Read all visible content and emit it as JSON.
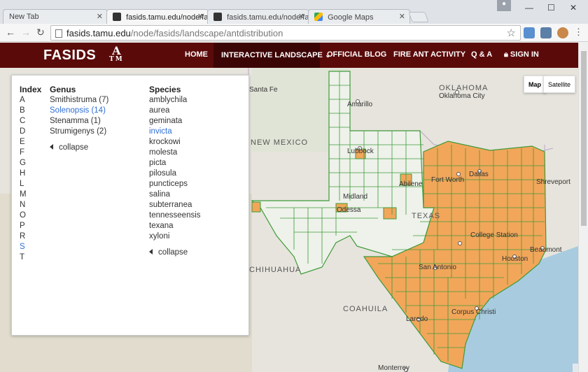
{
  "browser": {
    "tabs": [
      {
        "title": "New Tab",
        "active": false
      },
      {
        "title": "fasids.tamu.edu/node/fasi",
        "active": true
      },
      {
        "title": "fasids.tamu.edu/node/fasi",
        "active": false
      },
      {
        "title": "Google Maps",
        "active": false
      }
    ],
    "url_host": "fasids.tamu.edu",
    "url_path": "/node/fasids/landscape/antdistribution"
  },
  "site": {
    "logo": "FASIDS",
    "atm_logo_top": "A",
    "atm_logo_bottom": "TM",
    "nav": [
      {
        "label": "HOME"
      },
      {
        "label": "INTERACTIVE LANDSCAPE",
        "active": true
      },
      {
        "label": "OFFICIAL BLOG"
      },
      {
        "label": "FIRE ANT ACTIVITY"
      },
      {
        "label": "Q & A"
      },
      {
        "label": "SIGN IN"
      }
    ]
  },
  "map": {
    "type_buttons": [
      "Map",
      "Satellite"
    ],
    "labels": {
      "oklahoma": "OKLAHOMA",
      "oklahoma_city": "Oklahoma City",
      "santa_fe": "Santa Fe",
      "amarillo": "Amarillo",
      "new_mexico": "NEW MEXICO",
      "lubbock": "Lubbock",
      "abilene": "Abilene",
      "fort_worth": "Fort Worth",
      "dallas": "Dallas",
      "shreveport": "Shreveport",
      "midland": "Midland",
      "odessa": "Odessa",
      "texas": "TEXAS",
      "college_station": "College Station",
      "beaumont": "Beaumont",
      "san_antonio": "San Antonio",
      "houston": "Houston",
      "chihuahua": "CHIHUAHUA",
      "coahuila": "COAHUILA",
      "corpus_christi": "Corpus Christi",
      "laredo": "Laredo",
      "monterrey": "Monterrey"
    },
    "colors": {
      "infested": "#f2a65a",
      "border": "#3f9a3a",
      "land": "#e8e6df",
      "water": "#a8cbe0"
    }
  },
  "panel": {
    "index_title": "Index",
    "index": [
      "A",
      "B",
      "C",
      "D",
      "E",
      "F",
      "G",
      "H",
      "L",
      "M",
      "N",
      "O",
      "P",
      "R",
      "S",
      "T"
    ],
    "index_selected": "S",
    "genus_title": "Genus",
    "genera": [
      "Smithistruma (7)",
      "Solenopsis (14)",
      "Stenamma (1)",
      "Strumigenys (2)"
    ],
    "genus_selected": "Solenopsis (14)",
    "genus_collapse": "collapse",
    "species_title": "Species",
    "species": [
      "amblychila",
      "aurea",
      "geminata",
      "invicta",
      "krockowi",
      "molesta",
      "picta",
      "pilosula",
      "puncticeps",
      "salina",
      "subterranea",
      "tennesseensis",
      "texana",
      "xyloni"
    ],
    "species_selected": "invicta",
    "species_collapse": "collapse"
  }
}
